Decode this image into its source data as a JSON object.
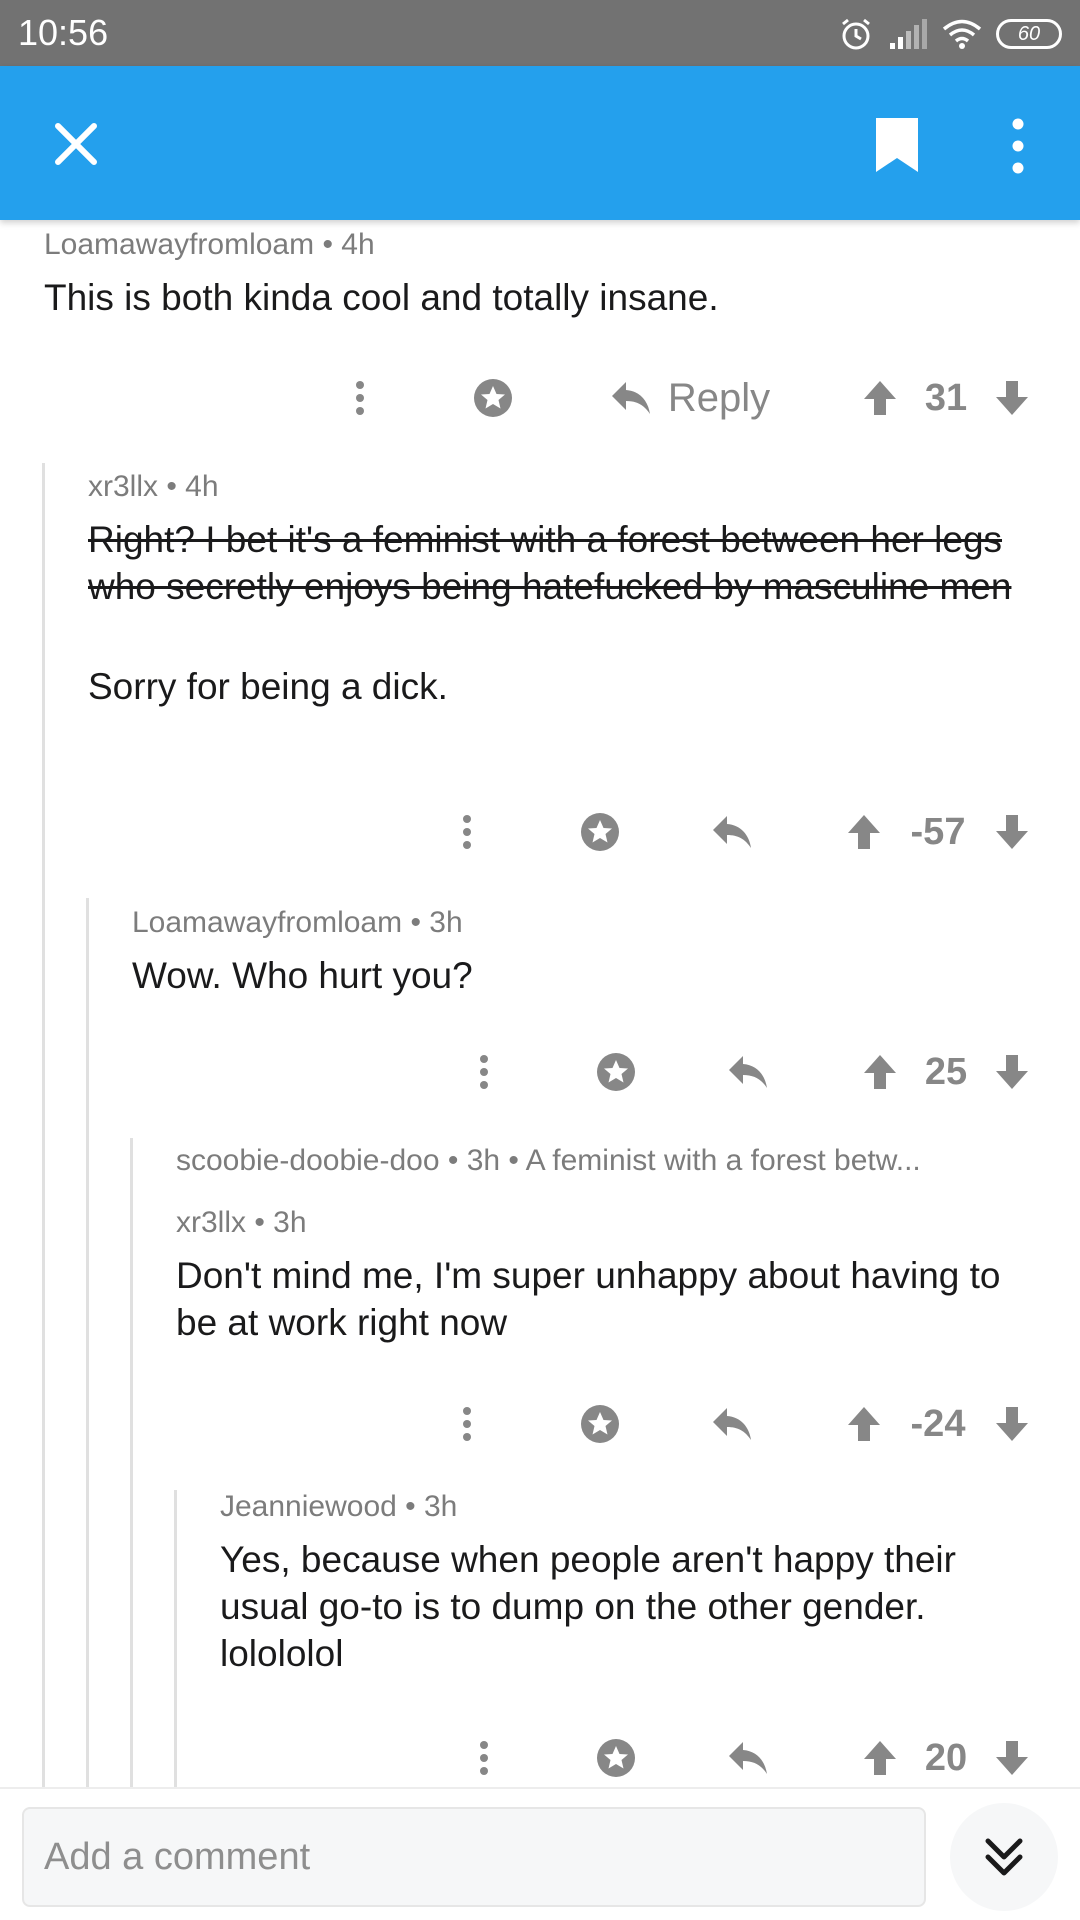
{
  "status_bar": {
    "time": "10:56",
    "battery": "60",
    "icons": [
      "alarm-icon",
      "signal-icon",
      "wifi-icon",
      "battery-icon"
    ]
  },
  "app_bar": {
    "color": "#24a0ed",
    "icons": [
      "close-icon",
      "bookmark-icon",
      "more-vertical-icon"
    ]
  },
  "comments": [
    {
      "author": "Loamawayfromloam",
      "time": "4h",
      "meta": "Loamawayfromloam • 4h",
      "body": "This is both kinda cool and totally insane.",
      "reply_label": "Reply",
      "score": "31"
    },
    {
      "author": "xr3llx",
      "time": "4h",
      "meta": "xr3llx • 4h",
      "body_struck": "Right? I bet it's a feminist with a forest between her legs who secretly enjoys being hatefucked by masculine men",
      "body": "Sorry for being a dick.",
      "score": "-57"
    },
    {
      "author": "Loamawayfromloam",
      "time": "3h",
      "meta": "Loamawayfromloam • 3h",
      "body": "Wow. Who hurt you?",
      "score": "25"
    },
    {
      "collapsed_meta": "scoobie-doobie-doo • 3h • A feminist with a forest betw...",
      "author": "xr3llx",
      "time": "3h",
      "meta": "xr3llx • 3h",
      "body": "Don't mind me, I'm super unhappy about having to be at work right now",
      "score": "-24"
    },
    {
      "author": "Jeanniewood",
      "time": "3h",
      "meta": "Jeanniewood • 3h",
      "body": "Yes, because when people aren't happy their usual go-to is to dump on the other gender. lolololol",
      "score": "20"
    }
  ],
  "bottom_bar": {
    "comment_placeholder": "Add a comment"
  }
}
